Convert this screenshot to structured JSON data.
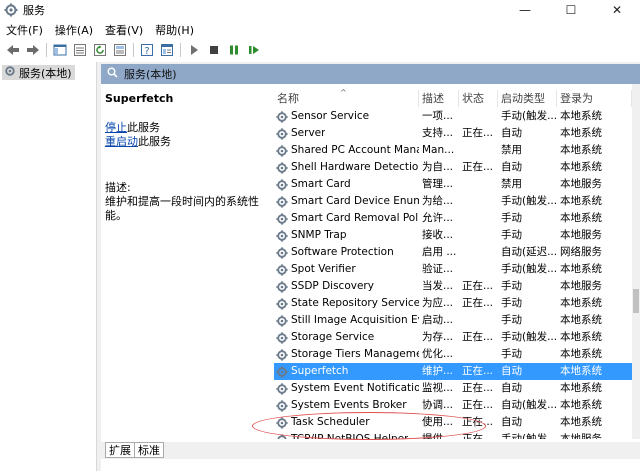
{
  "window": {
    "title": "服务",
    "minimize": "—",
    "maximize": "☐",
    "close": "✕"
  },
  "menu": [
    "文件(F)",
    "操作(A)",
    "查看(V)",
    "帮助(H)"
  ],
  "toolbar_icons": [
    "back-arrow-icon",
    "forward-arrow-icon",
    "console-tree-icon",
    "list-view-icon",
    "refresh-icon",
    "export-list-icon",
    "help-icon",
    "properties-icon",
    "start-service-icon",
    "stop-service-icon",
    "pause-service-icon",
    "restart-service-icon"
  ],
  "tree": {
    "root": "服务(本地)"
  },
  "panel": {
    "header": "服务(本地)",
    "selected_service": "Superfetch",
    "stop_link_1": "停止",
    "stop_link_2": "此服务",
    "restart_link_1": "重启动",
    "restart_link_2": "此服务",
    "desc_label": "描述:",
    "desc_text": "维护和提高一段时间内的系统性能。"
  },
  "columns": [
    "名称",
    "描述",
    "状态",
    "启动类型",
    "登录为"
  ],
  "services": [
    {
      "name": "Sensor Service",
      "desc": "一项...",
      "status": "",
      "startup": "手动(触发...",
      "logon": "本地系统"
    },
    {
      "name": "Server",
      "desc": "支持...",
      "status": "正在...",
      "startup": "自动",
      "logon": "本地系统"
    },
    {
      "name": "Shared PC Account Manager",
      "desc": "Man...",
      "status": "",
      "startup": "禁用",
      "logon": "本地系统"
    },
    {
      "name": "Shell Hardware Detection",
      "desc": "为自...",
      "status": "正在...",
      "startup": "自动",
      "logon": "本地系统"
    },
    {
      "name": "Smart Card",
      "desc": "管理...",
      "status": "",
      "startup": "禁用",
      "logon": "本地服务"
    },
    {
      "name": "Smart Card Device Enumer...",
      "desc": "为给...",
      "status": "",
      "startup": "手动(触发...",
      "logon": "本地系统"
    },
    {
      "name": "Smart Card Removal Policy",
      "desc": "允许...",
      "status": "",
      "startup": "手动",
      "logon": "本地系统"
    },
    {
      "name": "SNMP Trap",
      "desc": "接收...",
      "status": "",
      "startup": "手动",
      "logon": "本地服务"
    },
    {
      "name": "Software Protection",
      "desc": "启用 ...",
      "status": "",
      "startup": "自动(延迟...",
      "logon": "网络服务"
    },
    {
      "name": "Spot Verifier",
      "desc": "验证...",
      "status": "",
      "startup": "手动(触发...",
      "logon": "本地系统"
    },
    {
      "name": "SSDP Discovery",
      "desc": "当发...",
      "status": "正在...",
      "startup": "手动",
      "logon": "本地服务"
    },
    {
      "name": "State Repository Service",
      "desc": "为应...",
      "status": "正在...",
      "startup": "手动",
      "logon": "本地系统"
    },
    {
      "name": "Still Image Acquisition Eve...",
      "desc": "启动...",
      "status": "",
      "startup": "手动",
      "logon": "本地系统"
    },
    {
      "name": "Storage Service",
      "desc": "为存...",
      "status": "正在...",
      "startup": "手动(触发...",
      "logon": "本地系统"
    },
    {
      "name": "Storage Tiers Management",
      "desc": "优化...",
      "status": "",
      "startup": "手动",
      "logon": "本地系统"
    },
    {
      "name": "Superfetch",
      "desc": "维护...",
      "status": "正在...",
      "startup": "自动",
      "logon": "本地系统"
    },
    {
      "name": "System Event Notification ...",
      "desc": "监视...",
      "status": "正在...",
      "startup": "自动",
      "logon": "本地系统"
    },
    {
      "name": "System Events Broker",
      "desc": "协调...",
      "status": "正在...",
      "startup": "自动(触发...",
      "logon": "本地系统"
    },
    {
      "name": "Task Scheduler",
      "desc": "使用...",
      "status": "正在...",
      "startup": "自动",
      "logon": "本地系统"
    },
    {
      "name": "TCP/IP NetBIOS Helper",
      "desc": "提供...",
      "status": "正在...",
      "startup": "手动(触发...",
      "logon": "本地服务"
    }
  ],
  "selected_index": 15,
  "tabs": [
    "扩展",
    "标准"
  ],
  "colors": {
    "selection": "#3399ff",
    "panel_header": "#8fa8c8",
    "annotation": "#e05050"
  }
}
